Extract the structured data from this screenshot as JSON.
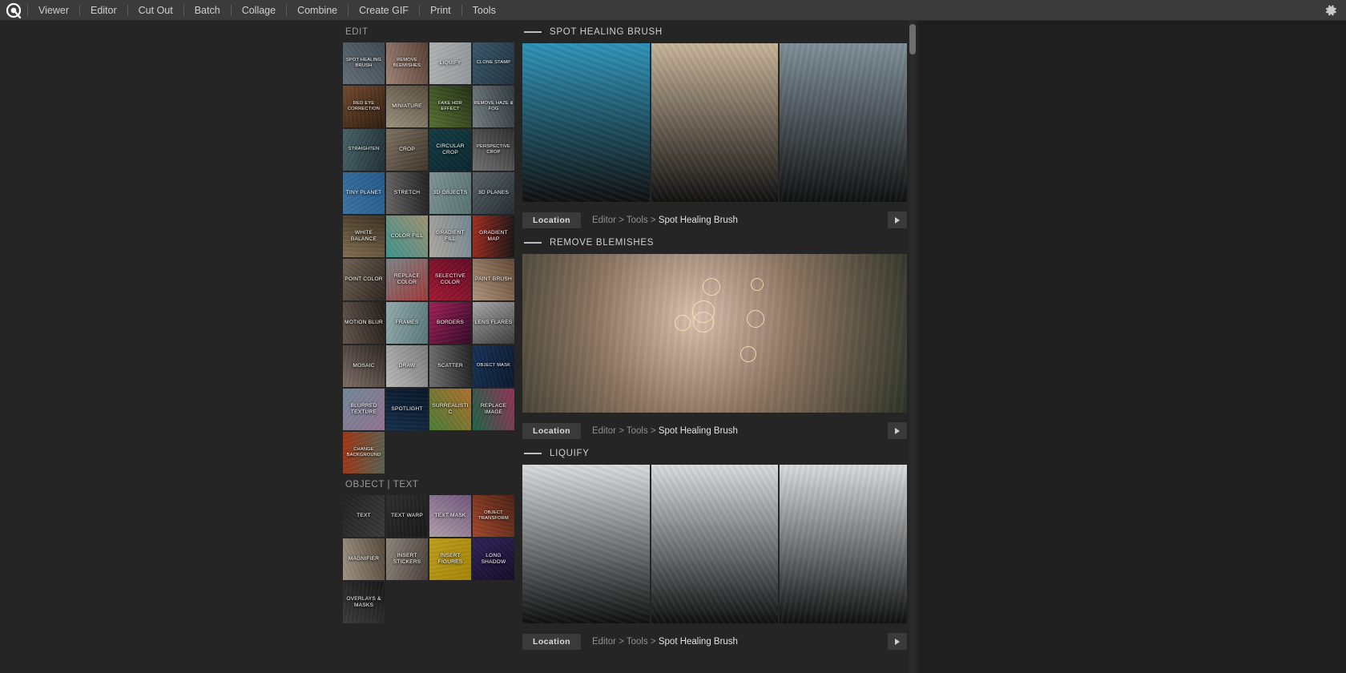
{
  "app": {
    "logo_icon": "pixlr-logo-icon",
    "gear_icon": "gear-icon",
    "menu": [
      {
        "label": "Viewer"
      },
      {
        "label": "Editor"
      },
      {
        "label": "Cut Out"
      },
      {
        "label": "Batch"
      },
      {
        "label": "Collage"
      },
      {
        "label": "Combine"
      },
      {
        "label": "Create GIF"
      },
      {
        "label": "Print"
      },
      {
        "label": "Tools"
      }
    ]
  },
  "sections": [
    {
      "title": "EDIT",
      "tiles": [
        {
          "label": "SPOT HEALING BRUSH",
          "selected": true,
          "c1": "#7d8a92",
          "c2": "#4d5b66",
          "small": true
        },
        {
          "label": "REMOVE BLEMISHES",
          "selected": false,
          "c1": "#c2a392",
          "c2": "#6b4f44",
          "small": true
        },
        {
          "label": "LIQUIFY",
          "selected": false,
          "c1": "#d8dcdd",
          "c2": "#b6bdbf",
          "small": false
        },
        {
          "label": "CLONE STAMP",
          "selected": false,
          "c1": "#4a6d84",
          "c2": "#2a3e4c",
          "small": true
        },
        {
          "label": "RED EYE CORRECTION",
          "selected": false,
          "c1": "#8a5c3a",
          "c2": "#3a2416",
          "small": true
        },
        {
          "label": "MINIATURE",
          "selected": false,
          "c1": "#c3b6a0",
          "c2": "#6b5f4d",
          "small": false
        },
        {
          "label": "FAKE HDR EFFECT",
          "selected": false,
          "c1": "#6d8a42",
          "c2": "#2d3d1c",
          "small": true
        },
        {
          "label": "REMOVE HAZE & FOG",
          "selected": false,
          "c1": "#8e9a9e",
          "c2": "#3e4850",
          "small": true
        },
        {
          "label": "STRAIGHTEN",
          "selected": false,
          "c1": "#5a7b80",
          "c2": "#2b3c42",
          "small": true
        },
        {
          "label": "CROP",
          "selected": false,
          "c1": "#9b8e7a",
          "c2": "#4d4438",
          "small": false
        },
        {
          "label": "CIRCULAR CROP",
          "selected": false,
          "c1": "#1b4a52",
          "c2": "#0f3038",
          "small": false
        },
        {
          "label": "PERSPECTIVE CROP",
          "selected": false,
          "c1": "#8d8d8d",
          "c2": "#3a3a3a",
          "small": true
        },
        {
          "label": "TINY PLANET",
          "selected": true,
          "c1": "#4e8fc4",
          "c2": "#2f6fa6",
          "small": false
        },
        {
          "label": "STRETCH",
          "selected": false,
          "c1": "#7e7e7e",
          "c2": "#2c2c2c",
          "small": false
        },
        {
          "label": "3D OBJECTS",
          "selected": false,
          "c1": "#9fb8b8",
          "c2": "#6d8c8c",
          "small": false
        },
        {
          "label": "3D PLANES",
          "selected": false,
          "c1": "#6e7a80",
          "c2": "#2e3840",
          "small": false
        },
        {
          "label": "WHITE BALANCE",
          "selected": false,
          "c1": "#a08866",
          "c2": "#4a3c2a",
          "small": false
        },
        {
          "label": "COLOR FILL",
          "selected": false,
          "c1": "#4fb6b0",
          "c2": "#c9b490",
          "small": false
        },
        {
          "label": "GRADIENT FILL",
          "selected": false,
          "c1": "#d8d0c6",
          "c2": "#8fa6b4",
          "small": false
        },
        {
          "label": "GRADIENT MAP",
          "selected": false,
          "c1": "#c23a2a",
          "c2": "#1b1b1b",
          "small": false
        },
        {
          "label": "POINT COLOR",
          "selected": false,
          "c1": "#8a7a6a",
          "c2": "#3a3028",
          "small": false
        },
        {
          "label": "REPLACE COLOR",
          "selected": false,
          "c1": "#9aa4a8",
          "c2": "#c0494a",
          "small": false
        },
        {
          "label": "SELECTIVE COLOR",
          "selected": false,
          "c1": "#c0213f",
          "c2": "#7a1030",
          "small": false
        },
        {
          "label": "PAINT BRUSH",
          "selected": false,
          "c1": "#d7b89c",
          "c2": "#7a5a42",
          "small": false
        },
        {
          "label": "MOTION BLUR",
          "selected": false,
          "c1": "#7a6a60",
          "c2": "#2e2620",
          "small": false
        },
        {
          "label": "FRAMES",
          "selected": false,
          "c1": "#b8d4d6",
          "c2": "#6f9396",
          "small": false
        },
        {
          "label": "BORDERS",
          "selected": false,
          "c1": "#c02a6a",
          "c2": "#3a1030",
          "small": false
        },
        {
          "label": "LENS FLARES",
          "selected": false,
          "c1": "#cfcfcf",
          "c2": "#4a4a4a",
          "small": false
        },
        {
          "label": "MOSAIC",
          "selected": false,
          "c1": "#9a8a80",
          "c2": "#3a302c",
          "small": false
        },
        {
          "label": "DRAW",
          "selected": false,
          "c1": "#e6e6e6",
          "c2": "#9a9a9a",
          "small": false
        },
        {
          "label": "SCATTER",
          "selected": false,
          "c1": "#8a8a8a",
          "c2": "#2e2e2e",
          "small": false
        },
        {
          "label": "OBJECT MASK",
          "selected": false,
          "c1": "#1f3f6a",
          "c2": "#0f1f36",
          "small": true
        },
        {
          "label": "BLURRED TEXTURE",
          "selected": false,
          "c1": "#8fa8bd",
          "c2": "#b48fb0",
          "small": false
        },
        {
          "label": "SPOTLIGHT",
          "selected": false,
          "c1": "#1d3a5c",
          "c2": "#0c1c30",
          "small": false
        },
        {
          "label": "SURREALISTIC",
          "selected": false,
          "c1": "#5a9a4a",
          "c2": "#d98a3a",
          "small": false
        },
        {
          "label": "REPLACE IMAGE",
          "selected": false,
          "c1": "#2a7a5a",
          "c2": "#b0406a",
          "small": false
        },
        {
          "label": "CHANGE BACKGROUND",
          "selected": false,
          "c1": "#c2441c",
          "c2": "#6a7a66",
          "small": true
        }
      ]
    },
    {
      "title": "OBJECT | TEXT",
      "tiles": [
        {
          "label": "TEXT",
          "selected": false,
          "c1": "#2a2a2a",
          "c2": "#4a4a4a",
          "small": false
        },
        {
          "label": "TEXT WARP",
          "selected": false,
          "c1": "#3a3a3a",
          "c2": "#1e1e1e",
          "small": false
        },
        {
          "label": "TEXT MASK",
          "selected": true,
          "c1": "#d8c6d0",
          "c2": "#8a6a9a",
          "small": false
        },
        {
          "label": "OBJECT TRANSFORM",
          "selected": false,
          "c1": "#c45a3a",
          "c2": "#5a2a1a",
          "small": true
        },
        {
          "label": "MAGNIFIER",
          "selected": false,
          "c1": "#c4b6a6",
          "c2": "#6a5c4c",
          "small": false
        },
        {
          "label": "INSERT STICKERS",
          "selected": false,
          "c1": "#b0a69a",
          "c2": "#5a5048",
          "small": false
        },
        {
          "label": "INSERT FIGURES",
          "selected": false,
          "c1": "#e8c32a",
          "c2": "#c9a410",
          "small": false
        },
        {
          "label": "LONG SHADOW",
          "selected": false,
          "c1": "#3a2a6a",
          "c2": "#1a1030",
          "small": false
        },
        {
          "label": "OVERLAYS & MASKS",
          "selected": false,
          "c1": "#4a4a4a",
          "c2": "#1e1e1e",
          "small": false
        }
      ]
    }
  ],
  "previews": [
    {
      "title": "SPOT HEALING BRUSH",
      "layout": "triple",
      "panes": [
        "pool-mural-photo",
        "concrete-numbers-photo",
        "beach-shore-photo"
      ],
      "location_label": "Location",
      "path_prefix": "Editor > Tools > ",
      "path_current": "Spot Healing Brush",
      "play_icon": "play-icon"
    },
    {
      "title": "REMOVE BLEMISHES",
      "layout": "single",
      "panes": [
        "portrait-neck-photo"
      ],
      "location_label": "Location",
      "path_prefix": "Editor > Tools > ",
      "path_current": "Spot Healing Brush",
      "play_icon": "play-icon"
    },
    {
      "title": "LIQUIFY",
      "layout": "triple",
      "panes": [
        "arctic-fox-photo",
        "arctic-fox-photo",
        "arctic-fox-photo"
      ],
      "location_label": "Location",
      "path_prefix": "Editor > Tools > ",
      "path_current": "Spot Healing Brush",
      "play_icon": "play-icon"
    }
  ],
  "colors": {
    "topbar_bg": "#3b3b3b",
    "panel_bg": "#252525",
    "app_bg": "#1e1e1e",
    "accent_selected": "#4e8fc4",
    "text_primary": "#cfcfcf",
    "text_muted": "#8f8f8f"
  }
}
